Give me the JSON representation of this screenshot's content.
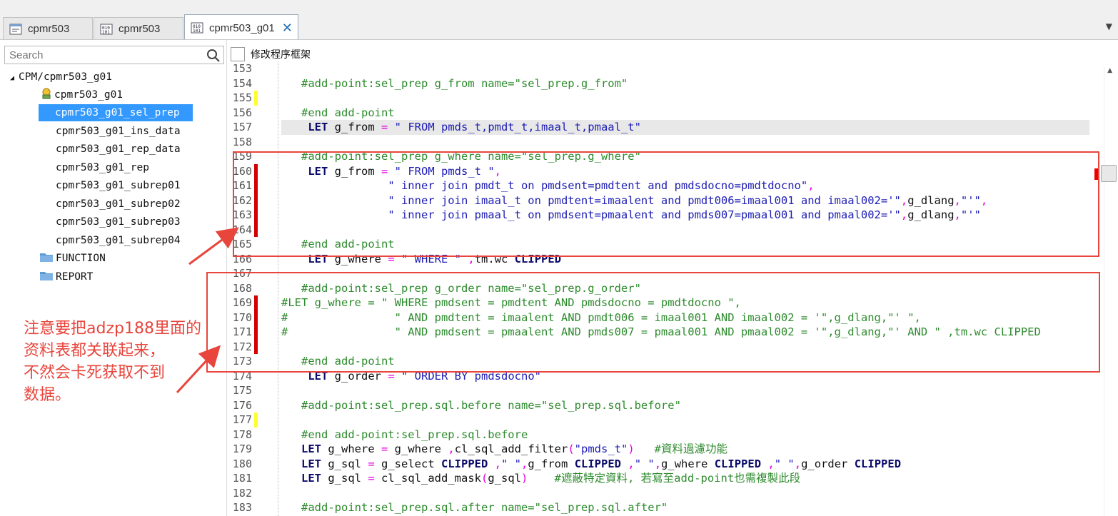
{
  "tabs": [
    {
      "label": "cpmr503",
      "icon": "form-icon",
      "active": false
    },
    {
      "label": "cpmr503",
      "icon": "binary-file-icon",
      "active": false
    },
    {
      "label": "cpmr503_g01",
      "icon": "binary-file-icon",
      "active": true
    }
  ],
  "search": {
    "placeholder": "Search"
  },
  "tree": {
    "root": "CPM/cpmr503_g01",
    "items": [
      "cpmr503_g01",
      "cpmr503_g01_sel_prep",
      "cpmr503_g01_ins_data",
      "cpmr503_g01_rep_data",
      "cpmr503_g01_rep",
      "cpmr503_g01_subrep01",
      "cpmr503_g01_subrep02",
      "cpmr503_g01_subrep03",
      "cpmr503_g01_subrep04",
      "FUNCTION",
      "REPORT"
    ],
    "selected": "cpmr503_g01_sel_prep"
  },
  "editor": {
    "checkbox_label": "修改程序框架",
    "lines": [
      {
        "n": "153",
        "t": ""
      },
      {
        "n": "154",
        "t": "   #add-point:sel_prep g_from name=\"sel_prep.g_from\""
      },
      {
        "n": "155",
        "t": ""
      },
      {
        "n": "156",
        "t": "   #end add-point"
      },
      {
        "n": "157",
        "t": "    LET g_from = \" FROM pmds_t,pmdt_t,imaal_t,pmaal_t\""
      },
      {
        "n": "158",
        "t": ""
      },
      {
        "n": "159",
        "t": "   #add-point:sel_prep g_where name=\"sel_prep.g_where\""
      },
      {
        "n": "160",
        "t": "    LET g_from = \" FROM pmds_t \","
      },
      {
        "n": "161",
        "t": "                \" inner join pmdt_t on pmdsent=pmdtent and pmdsdocno=pmdtdocno\","
      },
      {
        "n": "162",
        "t": "                \" inner join imaal_t on pmdtent=imaalent and pmdt006=imaal001 and imaal002='\",g_dlang,\"'\","
      },
      {
        "n": "163",
        "t": "                \" inner join pmaal_t on pmdsent=pmaalent and pmds007=pmaal001 and pmaal002='\",g_dlang,\"'\""
      },
      {
        "n": "164",
        "t": ""
      },
      {
        "n": "165",
        "t": "   #end add-point"
      },
      {
        "n": "166",
        "t": "    LET g_where = \" WHERE \" ,tm.wc CLIPPED"
      },
      {
        "n": "167",
        "t": ""
      },
      {
        "n": "168",
        "t": "   #add-point:sel_prep g_order name=\"sel_prep.g_order\""
      },
      {
        "n": "169",
        "t": "#LET g_where = \" WHERE pmdsent = pmdtent AND pmdsdocno = pmdtdocno \","
      },
      {
        "n": "170",
        "t": "#                \" AND pmdtent = imaalent AND pmdt006 = imaal001 AND imaal002 = '\",g_dlang,\"' \","
      },
      {
        "n": "171",
        "t": "#                \" AND pmdsent = pmaalent AND pmds007 = pmaal001 AND pmaal002 = '\",g_dlang,\"' AND \" ,tm.wc CLIPPED"
      },
      {
        "n": "172",
        "t": ""
      },
      {
        "n": "173",
        "t": "   #end add-point"
      },
      {
        "n": "174",
        "t": "    LET g_order = \" ORDER BY pmdsdocno\""
      },
      {
        "n": "175",
        "t": ""
      },
      {
        "n": "176",
        "t": "   #add-point:sel_prep.sql.before name=\"sel_prep.sql.before\""
      },
      {
        "n": "177",
        "t": ""
      },
      {
        "n": "178",
        "t": "   #end add-point:sel_prep.sql.before"
      },
      {
        "n": "179",
        "t": "   LET g_where = g_where ,cl_sql_add_filter(\"pmds_t\")   #資料過濾功能"
      },
      {
        "n": "180",
        "t": "   LET g_sql = g_select CLIPPED ,\" \",g_from CLIPPED ,\" \",g_where CLIPPED ,\" \",g_order CLIPPED"
      },
      {
        "n": "181",
        "t": "   LET g_sql = cl_sql_add_mask(g_sql)    #遮蔽特定資料, 若寫至add-point也需複製此段"
      },
      {
        "n": "182",
        "t": ""
      },
      {
        "n": "183",
        "t": "   #add-point:sel_prep.sql.after name=\"sel_prep.sql.after\""
      }
    ]
  },
  "annotation": {
    "lines": [
      "注意要把adzp188里面的",
      "资料表都关联起来，",
      "不然会卡死获取不到",
      "数据。"
    ]
  },
  "colors": {
    "annotation": "#e8453c",
    "selection": "#3399ff",
    "keyword": "#0b0b6b",
    "string": "#1e1eb4",
    "comment": "#2e8b2e"
  }
}
